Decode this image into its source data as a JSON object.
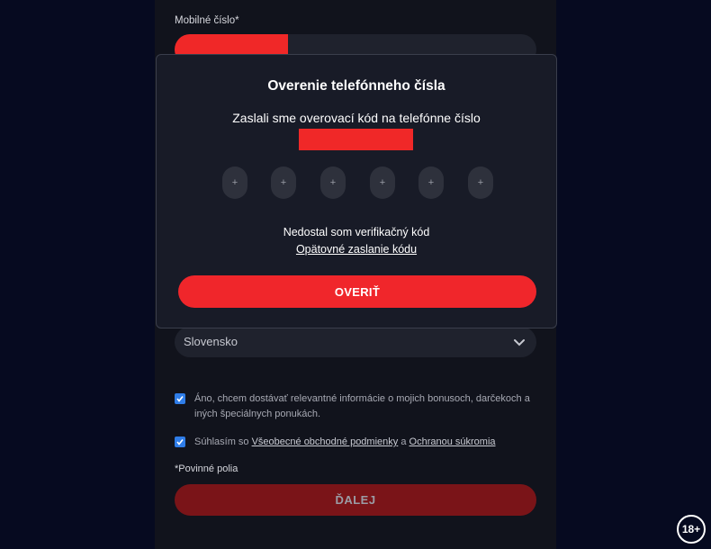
{
  "form": {
    "phone_label": "Mobilné číslo*",
    "country_value": "Slovensko",
    "consent_marketing": "Áno, chcem dostávať relevantné informácie o mojich bonusoch, darčekoch a iných špeciálnych ponukách.",
    "consent_terms_prefix": "Súhlasím so",
    "consent_terms_link": "Všeobecné obchodné podmienky",
    "consent_terms_join": "a",
    "consent_privacy_link": "Ochranou súkromia",
    "required_note": "*Povinné polia",
    "next_label": "ĎALEJ"
  },
  "modal": {
    "title": "Overenie telefónneho čísla",
    "message": "Zaslali sme overovací kód na telefónne číslo",
    "code_placeholders": [
      "+",
      "+",
      "+",
      "+",
      "+",
      "+"
    ],
    "resend_question": "Nedostal som verifikačný kód",
    "resend_link": "Opätovné zaslanie kódu",
    "verify_label": "OVERIŤ"
  },
  "badge": {
    "age": "18+"
  },
  "colors": {
    "background": "#060a20",
    "panel": "#11131c",
    "modal": "#181b27",
    "accent": "#f0262b",
    "redaction": "#f02828",
    "checkbox": "#2f7de8"
  }
}
